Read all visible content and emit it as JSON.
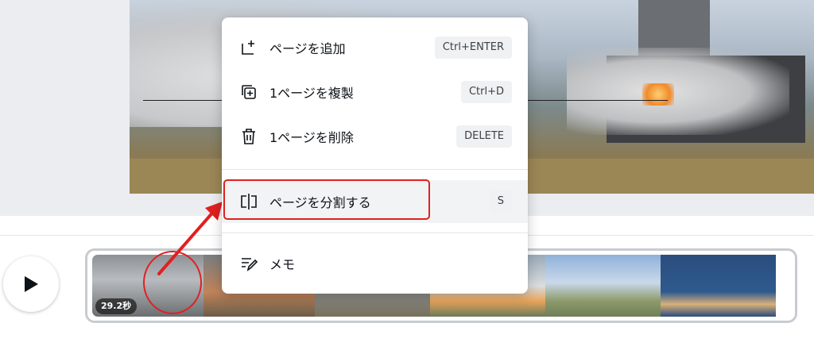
{
  "menu": {
    "items": [
      {
        "label": "ページを追加",
        "shortcut": "Ctrl+ENTER",
        "icon": "add-page-icon"
      },
      {
        "label": "1ページを複製",
        "shortcut": "Ctrl+D",
        "icon": "duplicate-icon"
      },
      {
        "label": "1ページを削除",
        "shortcut": "DELETE",
        "icon": "trash-icon"
      },
      {
        "label": "ページを分割する",
        "shortcut": "S",
        "icon": "split-icon"
      },
      {
        "label": "メモ",
        "icon": "notes-icon"
      }
    ]
  },
  "timeline": {
    "duration_badge": "29.2秒",
    "play_icon": "play-icon"
  },
  "colors": {
    "annotation_red": "#e02020",
    "menu_bg": "#ffffff",
    "shortcut_bg": "#f0f1f3"
  }
}
